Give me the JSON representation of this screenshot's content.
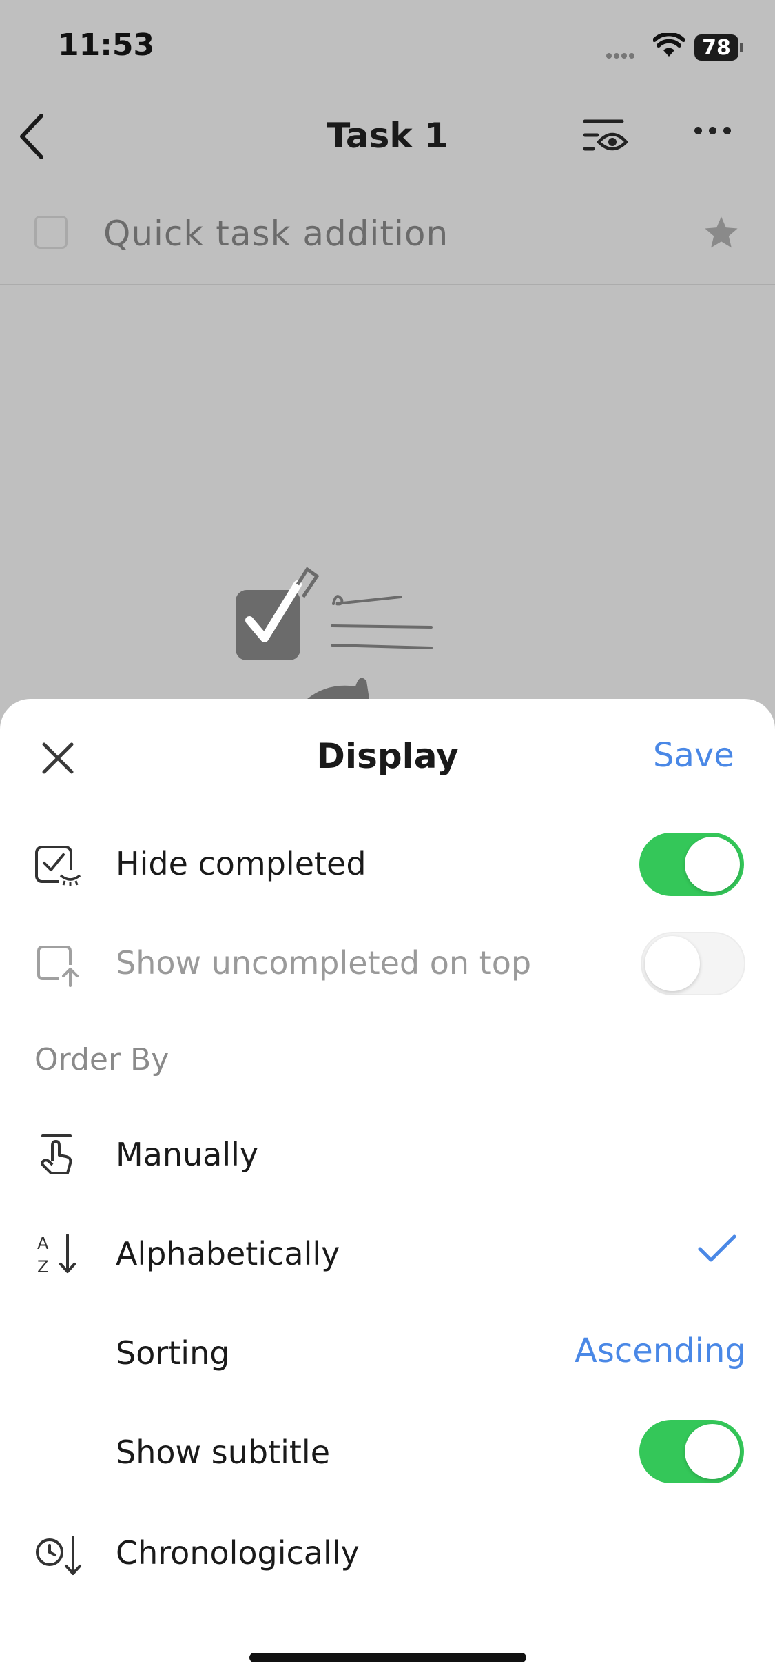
{
  "status_bar": {
    "time": "11:53",
    "battery": "78"
  },
  "nav": {
    "title": "Task 1"
  },
  "quick_add": {
    "placeholder": "Quick task addition"
  },
  "sheet": {
    "title": "Display",
    "save_label": "Save",
    "hide_completed": {
      "label": "Hide completed",
      "on": true
    },
    "show_uncompleted": {
      "label": "Show uncompleted on top",
      "on": false
    },
    "order_by_heading": "Order By",
    "order_options": [
      {
        "label": "Manually",
        "icon": "hand-drag-icon"
      },
      {
        "label": "Alphabetically",
        "icon": "az-sort-icon",
        "selected": true
      },
      {
        "label": "Chronologically",
        "icon": "clock-sort-icon"
      }
    ],
    "sorting": {
      "label": "Sorting",
      "value": "Ascending"
    },
    "show_subtitle": {
      "label": "Show subtitle",
      "on": true
    }
  },
  "colors": {
    "accent": "#4a88e6",
    "toggle_on": "#34c759",
    "overlay": "#bfbfbf"
  }
}
